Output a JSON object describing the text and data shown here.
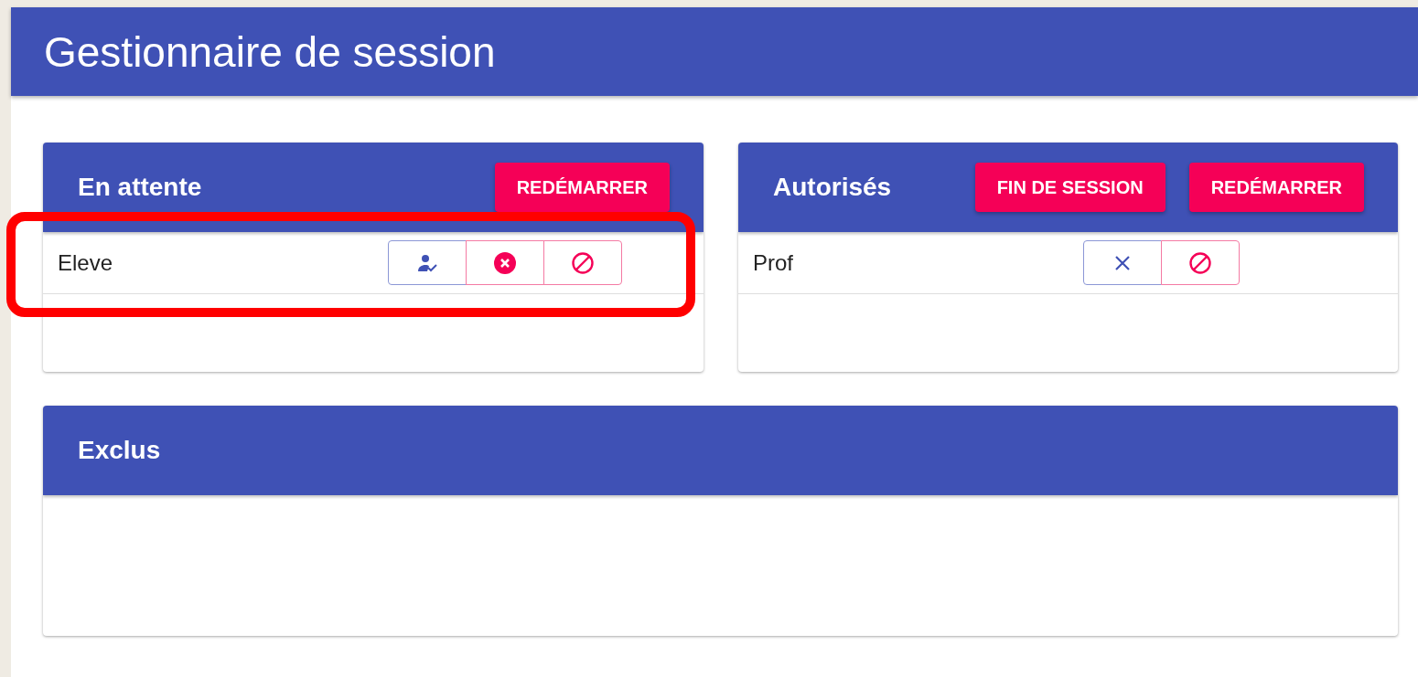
{
  "app_bar": {
    "title": "Gestionnaire de session"
  },
  "panels": [
    {
      "title": "En attente",
      "buttons": [
        "REDÉMARRER"
      ],
      "rows": [
        {
          "name": "Eleve",
          "actions": [
            {
              "kind": "approve"
            },
            {
              "kind": "reject"
            },
            {
              "kind": "ban"
            }
          ]
        }
      ]
    },
    {
      "title": "Autorisés",
      "buttons": [
        "FIN DE SESSION",
        "REDÉMARRER"
      ],
      "rows": [
        {
          "name": "Prof",
          "actions": [
            {
              "kind": "remove"
            },
            {
              "kind": "ban"
            }
          ]
        }
      ]
    },
    {
      "title": "Exclus"
    }
  ]
}
